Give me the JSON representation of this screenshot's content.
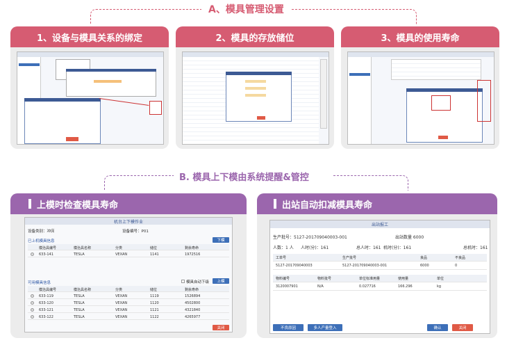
{
  "section_a": {
    "title": "A、模具管理设置"
  },
  "cards_top": [
    {
      "label": "1、设备与模具关系的绑定"
    },
    {
      "label": "2、模具的存放储位"
    },
    {
      "label": "3、模具的使用寿命"
    }
  ],
  "section_b": {
    "title": "B. 模具上下模由系统提醒&管控"
  },
  "cards_bottom": [
    {
      "label": "上模时检查模具寿命"
    },
    {
      "label": "出站自动扣减模具寿命"
    }
  ],
  "left_panel": {
    "window_title": "机台上下模作业",
    "device_type": "设备类别：冲床",
    "device_no": "设备编号：P01",
    "mounted_title": "已上机模具信息",
    "unload_btn": "下模",
    "mounted_headers": [
      "模治具编号",
      "模治具名称",
      "分类",
      "储位",
      "剩余寿命"
    ],
    "mounted_rows": [
      [
        "633-141",
        "TESLA",
        "VEXAN",
        "1141",
        "1972516"
      ]
    ],
    "available_title": "可用模具信息",
    "check_label": "模具自动下级",
    "load_btn": "上模",
    "avail_headers": [
      "模治具编号",
      "模治具名称",
      "分类",
      "储位",
      "剩余寿命"
    ],
    "avail_rows": [
      [
        "633-119",
        "TESLA",
        "VEXAN",
        "1119",
        "1526894"
      ],
      [
        "633-120",
        "TESLA",
        "VEXAN",
        "1120",
        "4502800"
      ],
      [
        "633-121",
        "TESLA",
        "VEXAN",
        "1121",
        "4321840"
      ],
      [
        "633-122",
        "TESLA",
        "VEXAN",
        "1122",
        "4265977"
      ]
    ],
    "close_btn": "关闭"
  },
  "right_panel": {
    "window_title": "出站报工",
    "prod_batch": "生产批号：5127-201709040003-001",
    "out_qty": "出站数量 6000",
    "people": "人数：1 人",
    "time1": "人时(分)：161",
    "time2": "总人时：161",
    "time3": "机时(分)：161",
    "time4": "总机时：161",
    "headers1": [
      "工单号",
      "生产批号",
      "良品",
      "不良品"
    ],
    "row1": [
      "5127-201709040003",
      "5127-201709040003-001",
      "6000",
      "0"
    ],
    "headers2": [
      "物料编号",
      "物料批号",
      "单位标准用量",
      "使用量",
      "单位"
    ],
    "row2": [
      "3120007901",
      "N/A",
      "0.027716",
      "166.296",
      "kg"
    ],
    "btn_defect": "不良原因",
    "btn_multi": "多人产量登入",
    "btn_confirm": "确认",
    "btn_close": "关闭"
  },
  "colors": {
    "pink": "#d65c72",
    "purple": "#9b66ad",
    "blue": "#3d5a94"
  }
}
